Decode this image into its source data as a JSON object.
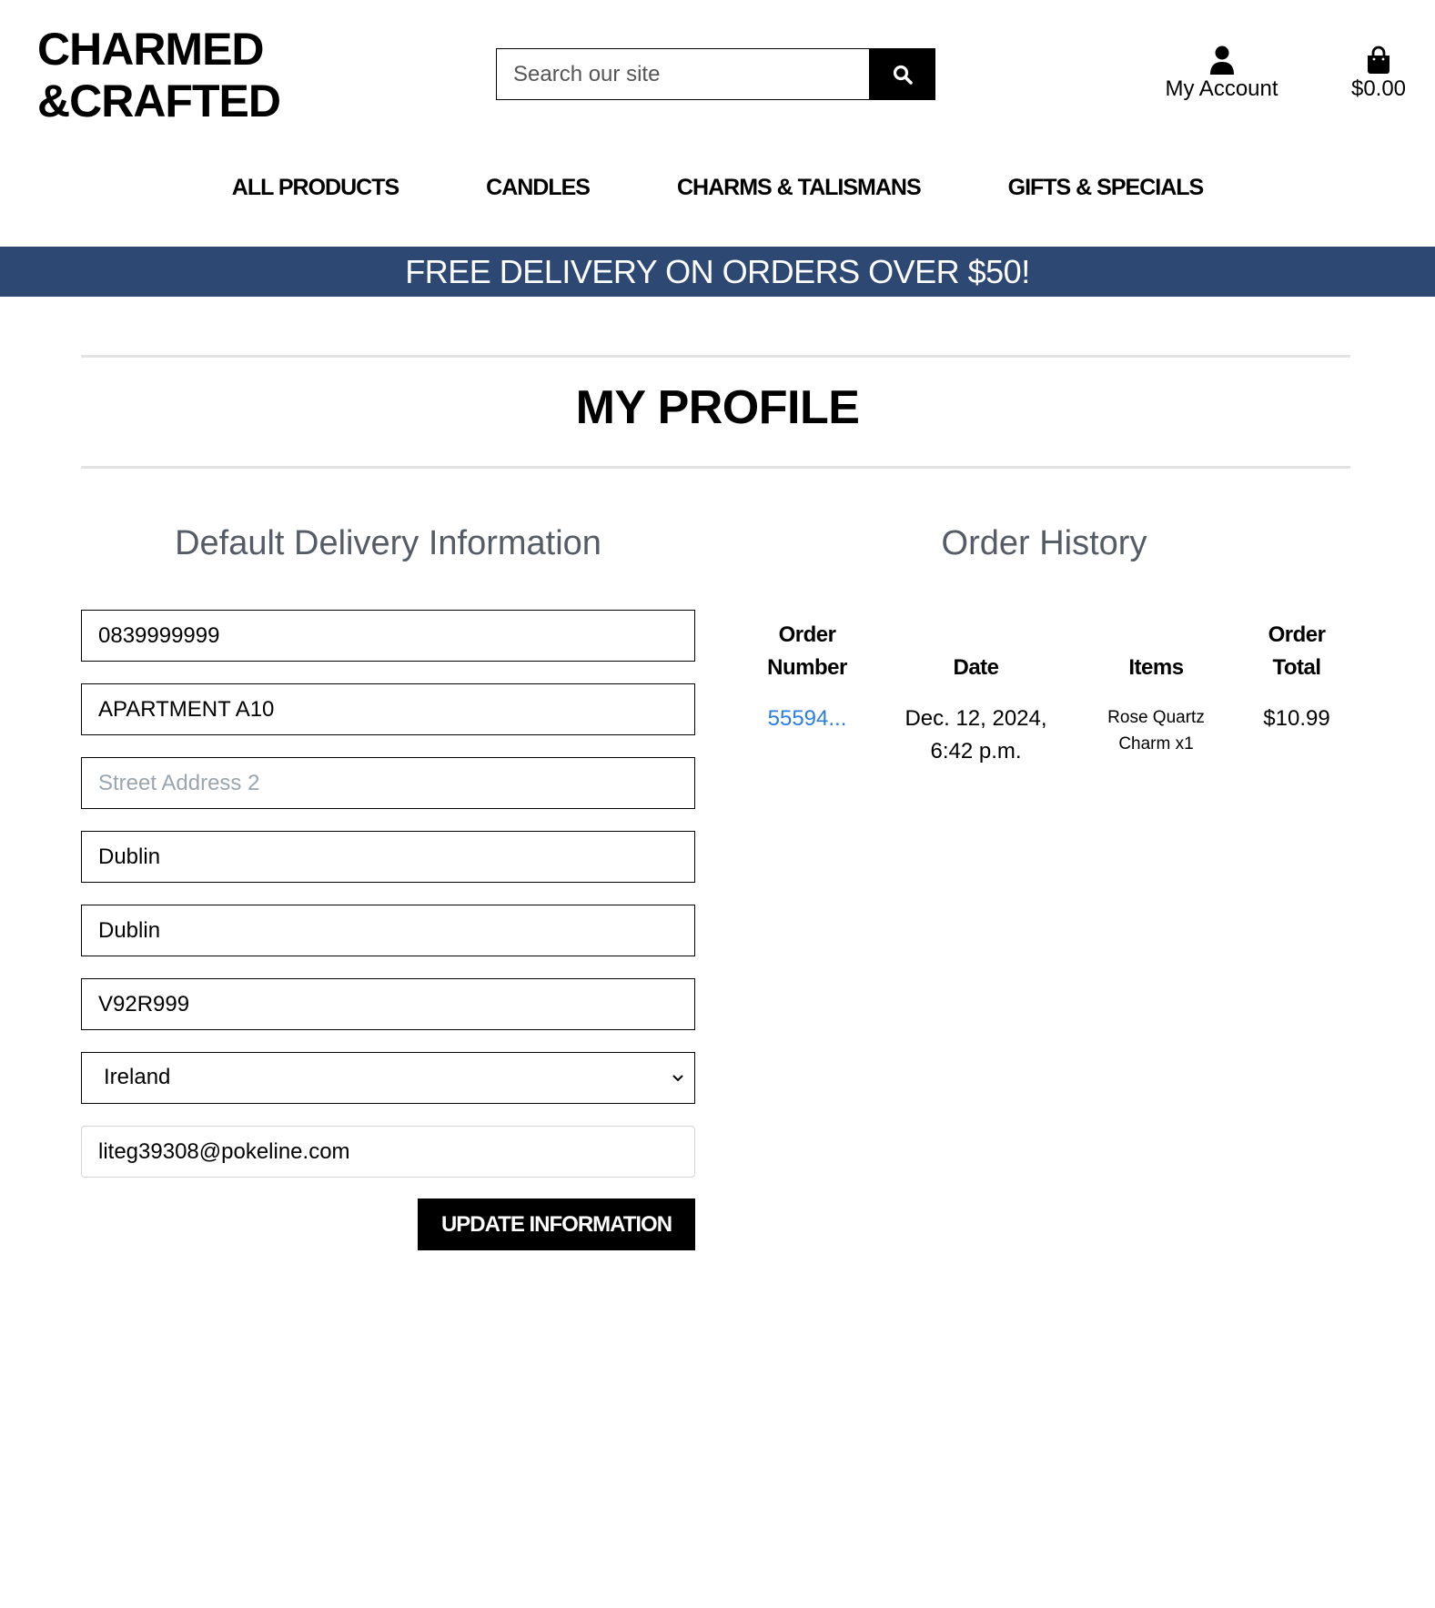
{
  "brand": {
    "line1": "CHARMED",
    "line2": "&CRAFTED"
  },
  "search": {
    "placeholder": "Search our site"
  },
  "account": {
    "label": "My Account"
  },
  "bag": {
    "total": "$0.00"
  },
  "nav": [
    "ALL PRODUCTS",
    "CANDLES",
    "CHARMS & TALISMANS",
    "GIFTS & SPECIALS"
  ],
  "banner": {
    "text": "FREE DELIVERY ON ORDERS OVER $50!"
  },
  "page": {
    "title": "MY PROFILE"
  },
  "delivery": {
    "heading": "Default Delivery Information",
    "phone": "0839999999",
    "street1": "APARTMENT A10",
    "street2_placeholder": "Street Address 2",
    "town": "Dublin",
    "county": "Dublin",
    "postcode": "V92R999",
    "country": "Ireland",
    "email": "liteg39308@pokeline.com",
    "update_label": "UPDATE INFORMATION"
  },
  "orders": {
    "heading": "Order History",
    "columns": {
      "number": "Order Number",
      "date": "Date",
      "items": "Items",
      "total": "Order Total"
    },
    "rows": [
      {
        "number": "55594...",
        "date": "Dec. 12, 2024, 6:42 p.m.",
        "items": "Rose Quartz Charm x1",
        "total": "$10.99"
      }
    ]
  },
  "colors": {
    "banner": "#2e4874",
    "link": "#2a7de1",
    "heading_gray": "#555c66"
  }
}
